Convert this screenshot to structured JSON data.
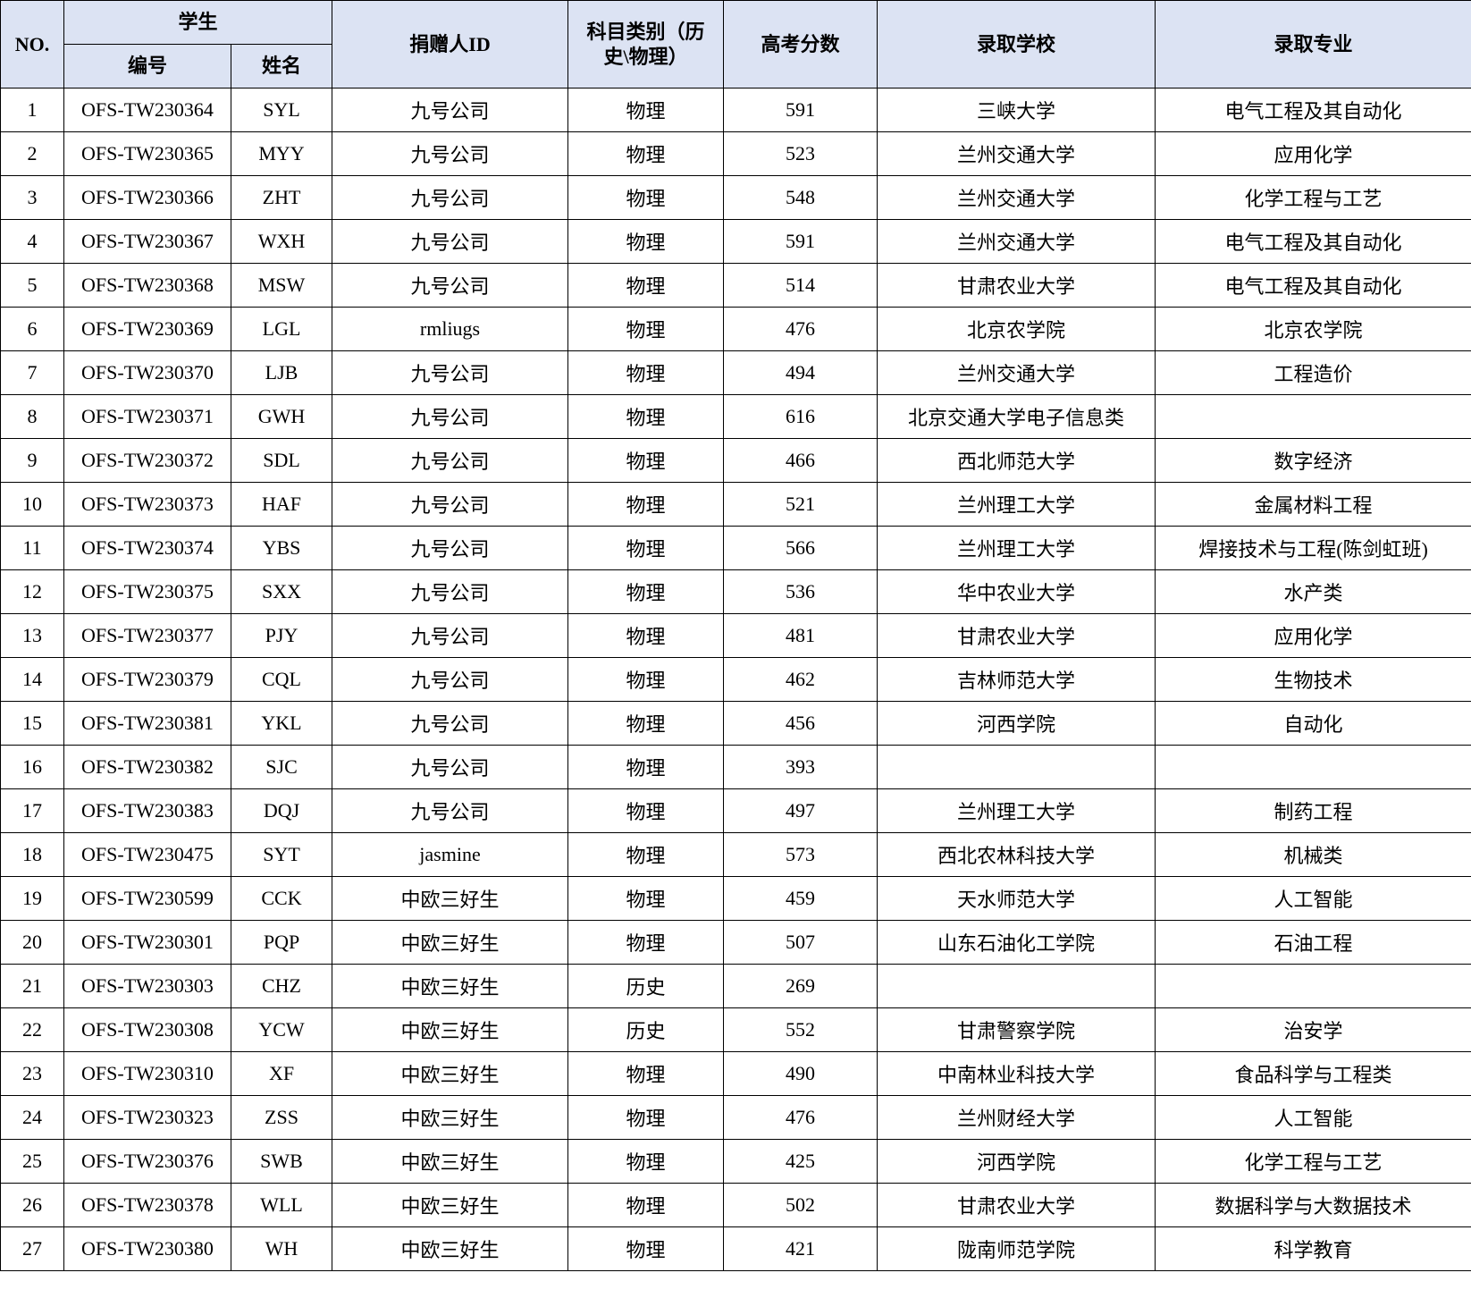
{
  "headers": {
    "no": "NO.",
    "student": "学生",
    "student_id": "编号",
    "student_name": "姓名",
    "donor_id": "捐赠人ID",
    "subject": "科目类别（历史\\物理）",
    "score": "高考分数",
    "school": "录取学校",
    "major": "录取专业"
  },
  "rows": [
    {
      "no": "1",
      "id": "OFS-TW230364",
      "name": "SYL",
      "donor": "九号公司",
      "subject": "物理",
      "score": "591",
      "school": "三峡大学",
      "major": "电气工程及其自动化"
    },
    {
      "no": "2",
      "id": "OFS-TW230365",
      "name": "MYY",
      "donor": "九号公司",
      "subject": "物理",
      "score": "523",
      "school": "兰州交通大学",
      "major": "应用化学"
    },
    {
      "no": "3",
      "id": "OFS-TW230366",
      "name": "ZHT",
      "donor": "九号公司",
      "subject": "物理",
      "score": "548",
      "school": "兰州交通大学",
      "major": "化学工程与工艺"
    },
    {
      "no": "4",
      "id": "OFS-TW230367",
      "name": "WXH",
      "donor": "九号公司",
      "subject": "物理",
      "score": "591",
      "school": "兰州交通大学",
      "major": "电气工程及其自动化"
    },
    {
      "no": "5",
      "id": "OFS-TW230368",
      "name": "MSW",
      "donor": "九号公司",
      "subject": "物理",
      "score": "514",
      "school": "甘肃农业大学",
      "major": "电气工程及其自动化"
    },
    {
      "no": "6",
      "id": "OFS-TW230369",
      "name": "LGL",
      "donor": "rmliugs",
      "subject": "物理",
      "score": "476",
      "school": "北京农学院",
      "major": "北京农学院"
    },
    {
      "no": "7",
      "id": "OFS-TW230370",
      "name": "LJB",
      "donor": "九号公司",
      "subject": "物理",
      "score": "494",
      "school": "兰州交通大学",
      "major": "工程造价"
    },
    {
      "no": "8",
      "id": "OFS-TW230371",
      "name": "GWH",
      "donor": "九号公司",
      "subject": "物理",
      "score": "616",
      "school": "北京交通大学电子信息类",
      "major": ""
    },
    {
      "no": "9",
      "id": "OFS-TW230372",
      "name": "SDL",
      "donor": "九号公司",
      "subject": "物理",
      "score": "466",
      "school": "西北师范大学",
      "major": "数字经济"
    },
    {
      "no": "10",
      "id": "OFS-TW230373",
      "name": "HAF",
      "donor": "九号公司",
      "subject": "物理",
      "score": "521",
      "school": "兰州理工大学",
      "major": "金属材料工程"
    },
    {
      "no": "11",
      "id": "OFS-TW230374",
      "name": "YBS",
      "donor": "九号公司",
      "subject": "物理",
      "score": "566",
      "school": "兰州理工大学",
      "major": "焊接技术与工程(陈剑虹班)"
    },
    {
      "no": "12",
      "id": "OFS-TW230375",
      "name": "SXX",
      "donor": "九号公司",
      "subject": "物理",
      "score": "536",
      "school": "华中农业大学",
      "major": "水产类"
    },
    {
      "no": "13",
      "id": "OFS-TW230377",
      "name": "PJY",
      "donor": "九号公司",
      "subject": "物理",
      "score": "481",
      "school": "甘肃农业大学",
      "major": "应用化学"
    },
    {
      "no": "14",
      "id": "OFS-TW230379",
      "name": "CQL",
      "donor": "九号公司",
      "subject": "物理",
      "score": "462",
      "school": "吉林师范大学",
      "major": "生物技术"
    },
    {
      "no": "15",
      "id": "OFS-TW230381",
      "name": "YKL",
      "donor": "九号公司",
      "subject": "物理",
      "score": "456",
      "school": "河西学院",
      "major": "自动化"
    },
    {
      "no": "16",
      "id": "OFS-TW230382",
      "name": "SJC",
      "donor": "九号公司",
      "subject": "物理",
      "score": "393",
      "school": "",
      "major": ""
    },
    {
      "no": "17",
      "id": "OFS-TW230383",
      "name": "DQJ",
      "donor": "九号公司",
      "subject": "物理",
      "score": "497",
      "school": "兰州理工大学",
      "major": "制药工程"
    },
    {
      "no": "18",
      "id": "OFS-TW230475",
      "name": "SYT",
      "donor": "jasmine",
      "subject": "物理",
      "score": "573",
      "school": "西北农林科技大学",
      "major": "机械类"
    },
    {
      "no": "19",
      "id": "OFS-TW230599",
      "name": "CCK",
      "donor": "中欧三好生",
      "subject": "物理",
      "score": "459",
      "school": "天水师范大学",
      "major": "人工智能"
    },
    {
      "no": "20",
      "id": "OFS-TW230301",
      "name": "PQP",
      "donor": "中欧三好生",
      "subject": "物理",
      "score": "507",
      "school": "山东石油化工学院",
      "major": "石油工程"
    },
    {
      "no": "21",
      "id": "OFS-TW230303",
      "name": "CHZ",
      "donor": "中欧三好生",
      "subject": "历史",
      "score": "269",
      "school": "",
      "major": ""
    },
    {
      "no": "22",
      "id": "OFS-TW230308",
      "name": "YCW",
      "donor": "中欧三好生",
      "subject": "历史",
      "score": "552",
      "school": "甘肃警察学院",
      "major": "治安学"
    },
    {
      "no": "23",
      "id": "OFS-TW230310",
      "name": "XF",
      "donor": "中欧三好生",
      "subject": "物理",
      "score": "490",
      "school": "中南林业科技大学",
      "major": "食品科学与工程类"
    },
    {
      "no": "24",
      "id": "OFS-TW230323",
      "name": "ZSS",
      "donor": "中欧三好生",
      "subject": "物理",
      "score": "476",
      "school": "兰州财经大学",
      "major": "人工智能"
    },
    {
      "no": "25",
      "id": "OFS-TW230376",
      "name": "SWB",
      "donor": "中欧三好生",
      "subject": "物理",
      "score": "425",
      "school": "河西学院",
      "major": "化学工程与工艺"
    },
    {
      "no": "26",
      "id": "OFS-TW230378",
      "name": "WLL",
      "donor": "中欧三好生",
      "subject": "物理",
      "score": "502",
      "school": "甘肃农业大学",
      "major": "数据科学与大数据技术"
    },
    {
      "no": "27",
      "id": "OFS-TW230380",
      "name": "WH",
      "donor": "中欧三好生",
      "subject": "物理",
      "score": "421",
      "school": "陇南师范学院",
      "major": "科学教育"
    }
  ],
  "colors": {
    "header_bg": "#dce3f3",
    "border": "#000000"
  }
}
